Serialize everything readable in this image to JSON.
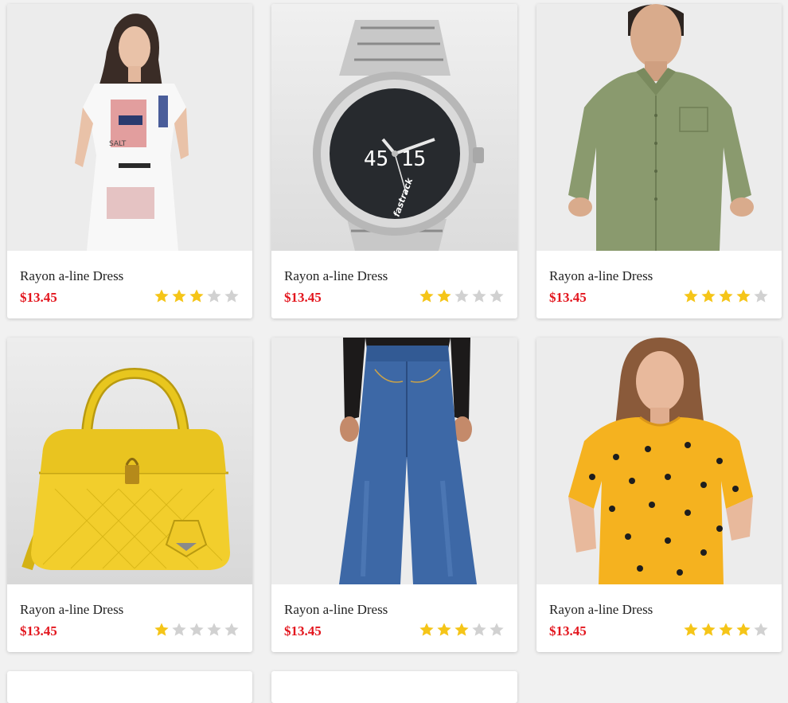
{
  "colors": {
    "price": "#e3161e",
    "star_filled": "#f5c518",
    "star_empty": "#d1d1d1",
    "background": "#f1f1f1"
  },
  "products": [
    {
      "name": "Rayon a-line Dress",
      "price": "$13.45",
      "rating": 3,
      "image_icon": "dress-photo",
      "image_text": "SALT"
    },
    {
      "name": "Rayon a-line Dress",
      "price": "$13.45",
      "rating": 2,
      "image_icon": "watch-photo",
      "image_text": "45   15",
      "image_brand": "fastrack"
    },
    {
      "name": "Rayon a-line Dress",
      "price": "$13.45",
      "rating": 4,
      "image_icon": "shirt-photo"
    },
    {
      "name": "Rayon a-line Dress",
      "price": "$13.45",
      "rating": 1,
      "image_icon": "handbag-photo"
    },
    {
      "name": "Rayon a-line Dress",
      "price": "$13.45",
      "rating": 3,
      "image_icon": "jeans-photo"
    },
    {
      "name": "Rayon a-line Dress",
      "price": "$13.45",
      "rating": 4,
      "image_icon": "tshirt-photo"
    }
  ],
  "max_rating": 5
}
